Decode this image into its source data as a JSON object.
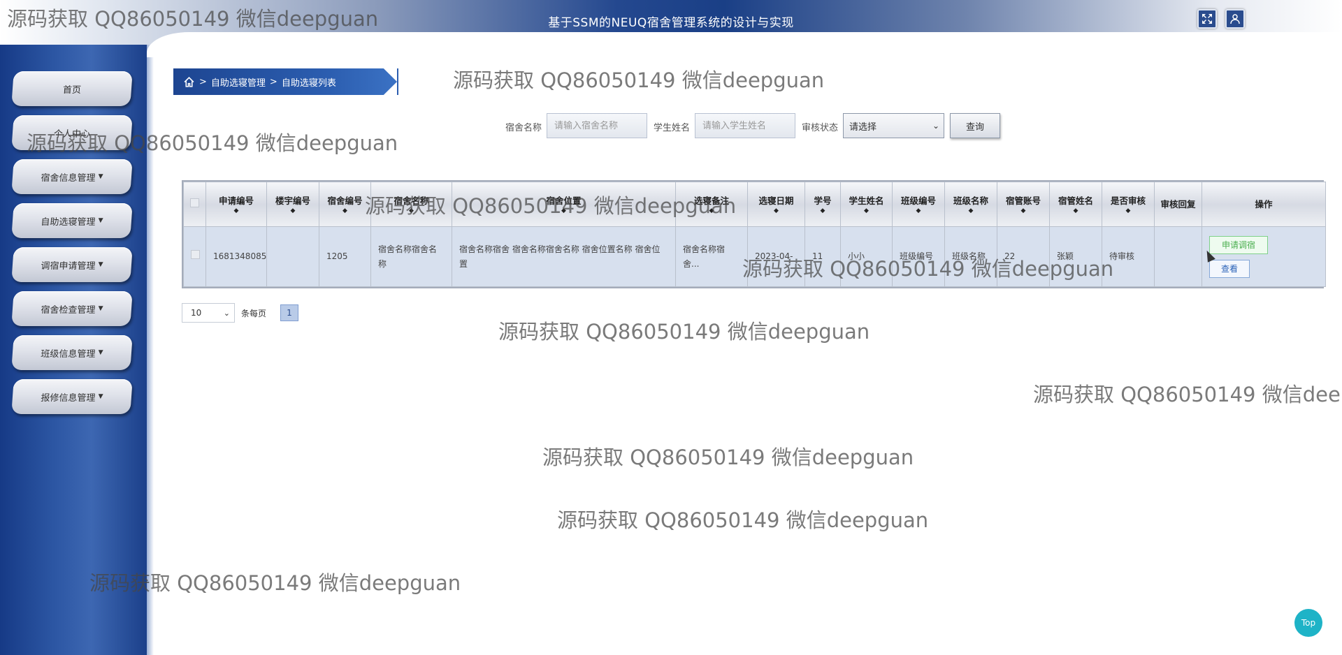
{
  "header": {
    "title": "基于SSM的NEUQ宿舍管理系统的设计与实现"
  },
  "sidebar": {
    "items": [
      {
        "label": "首页",
        "has_caret": false
      },
      {
        "label": "个人中心",
        "has_caret": false
      },
      {
        "label": "宿舍信息管理",
        "has_caret": true
      },
      {
        "label": "自助选寝管理",
        "has_caret": true
      },
      {
        "label": "调宿申请管理",
        "has_caret": true
      },
      {
        "label": "宿舍检查管理",
        "has_caret": true
      },
      {
        "label": "班级信息管理",
        "has_caret": true
      },
      {
        "label": "报修信息管理",
        "has_caret": true
      }
    ]
  },
  "breadcrumb": {
    "sep": ">",
    "level1": "自助选寝管理",
    "level2": "自助选寝列表"
  },
  "search": {
    "dorm_label": "宿舍名称",
    "dorm_placeholder": "请输入宿舍名称",
    "student_label": "学生姓名",
    "student_placeholder": "请输入学生姓名",
    "status_label": "审核状态",
    "status_value": "请选择",
    "query_button": "查询"
  },
  "table": {
    "headers": [
      "申请编号",
      "楼宇编号",
      "宿舍编号",
      "宿舍名称",
      "宿舍位置",
      "选寝备注",
      "选寝日期",
      "学号",
      "学生姓名",
      "班级编号",
      "班级名称",
      "宿管账号",
      "宿管姓名",
      "是否审核",
      "审核回复",
      "操作"
    ],
    "rows": [
      {
        "apply_no": "1681348085",
        "building_no": "",
        "dorm_no": "1205",
        "dorm_name": "宿舍名称宿舍名称",
        "dorm_location": "宿舍名称宿舍 宿舍名称宿舍名称 宿舍位置名称 宿舍位置",
        "remark": "宿舍名称宿舍...",
        "date": "2023-04-",
        "student_no": "11",
        "student_name": "小小",
        "class_no": "班级编号",
        "class_name": "班级名称",
        "manager_account": "22",
        "manager_name": "张颖",
        "audit": "待审核",
        "audit_reply": "",
        "btn_change": "申请调宿",
        "btn_view": "查看"
      }
    ]
  },
  "pagination": {
    "page_size": "10",
    "per_page_label": "条每页",
    "current_page": "1"
  },
  "watermark": "源码获取 QQ86050149 微信deepguan",
  "top_button": "Top"
}
